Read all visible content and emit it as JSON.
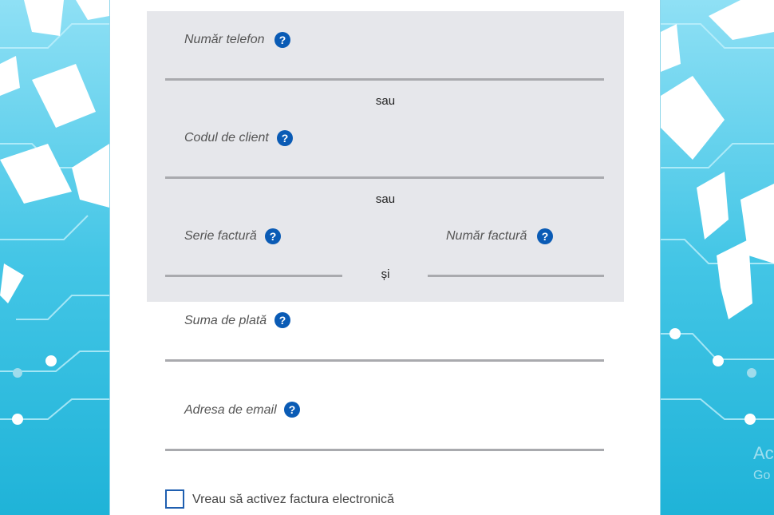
{
  "form": {
    "phone": {
      "label": "Număr telefon",
      "help": "?"
    },
    "sep1": "sau",
    "client_code": {
      "label": "Codul de client",
      "help": "?"
    },
    "sep2": "sau",
    "invoice_series": {
      "label": "Serie factură",
      "help": "?"
    },
    "and_label": "și",
    "invoice_number": {
      "label": "Număr factură",
      "help": "?"
    },
    "amount": {
      "label": "Suma de plată",
      "help": "?"
    },
    "email": {
      "label": "Adresa de email",
      "help": "?"
    },
    "e_invoice": {
      "label": "Vreau să activez factura electronică",
      "checked": false
    }
  },
  "watermark": {
    "line1": "Ac",
    "line2": "Go"
  },
  "colors": {
    "accent": "#0a5bb5",
    "panel": "#e6e7eb",
    "underline": "#a9aaae",
    "background": "#3cc3e2"
  }
}
